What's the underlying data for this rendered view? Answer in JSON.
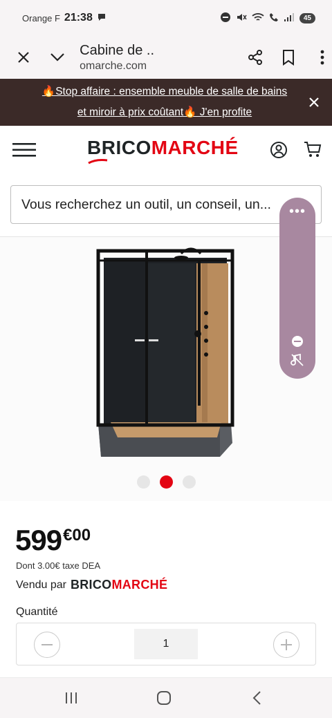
{
  "status_bar": {
    "carrier": "Orange F",
    "time": "21:38",
    "battery": "45"
  },
  "browser": {
    "page_title": "Cabine de ...",
    "url": "omarche.com"
  },
  "promo": {
    "line1": "🔥Stop affaire : ensemble meuble de salle de bains",
    "line2": "et miroir à prix coûtant🔥 J'en profite"
  },
  "header": {
    "logo_part1": "BRICO",
    "logo_part2": "MARCHÉ"
  },
  "search": {
    "placeholder": "Vous recherchez un outil, un conseil, un..."
  },
  "carousel": {
    "slide_count": 3,
    "active_index": 1
  },
  "floating_widget": {
    "more_label": "•••"
  },
  "product": {
    "price_int": "599",
    "price_dec": "€00",
    "tax_note": "Dont 3.00€ taxe DEA",
    "sold_by_label": "Vendu par",
    "seller_part1": "BRICO",
    "seller_part2": "MARCHÉ",
    "quantity_label": "Quantité",
    "quantity_value": "1"
  },
  "colors": {
    "brand_red": "#e30513",
    "brand_dark": "#1f2426",
    "banner_bg": "#3b2a28",
    "floating_bg": "#a888a0"
  }
}
